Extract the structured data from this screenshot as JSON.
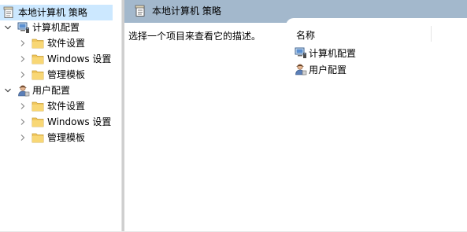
{
  "tree": {
    "root": {
      "label": "本地计算机 策略",
      "icon": "policy-document-icon"
    },
    "computer_config": {
      "label": "计算机配置",
      "icon": "computer-icon",
      "expanded": true,
      "children": [
        {
          "label": "软件设置",
          "icon": "folder-icon"
        },
        {
          "label": "Windows 设置",
          "icon": "folder-icon"
        },
        {
          "label": "管理模板",
          "icon": "folder-icon"
        }
      ]
    },
    "user_config": {
      "label": "用户配置",
      "icon": "user-icon",
      "expanded": true,
      "children": [
        {
          "label": "软件设置",
          "icon": "folder-icon"
        },
        {
          "label": "Windows 设置",
          "icon": "folder-icon"
        },
        {
          "label": "管理模板",
          "icon": "folder-icon"
        }
      ]
    }
  },
  "content": {
    "header_title": "本地计算机 策略",
    "description": "选择一个项目来查看它的描述。",
    "column_header": "名称",
    "items": [
      {
        "label": "计算机配置",
        "icon": "computer-icon"
      },
      {
        "label": "用户配置",
        "icon": "user-icon"
      }
    ]
  },
  "colors": {
    "selection": "#cce8ff",
    "header_band": "#a3b8cc",
    "folder": "#f1c75d"
  }
}
